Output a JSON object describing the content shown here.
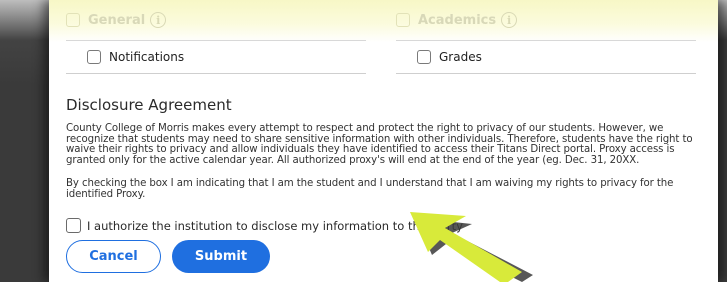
{
  "permissions": {
    "left_group": {
      "heading": "General",
      "item": "Notifications"
    },
    "right_group": {
      "heading": "Academics",
      "item": "Grades"
    }
  },
  "disclosure": {
    "title": "Disclosure Agreement",
    "paragraph1": "County College of Morris makes every attempt to respect and protect the right to privacy of our students. However, we recognize that students may need to share sensitive information with other individuals. Therefore, students have the right to waive their rights to privacy and allow individuals they have identified to access their Titans Direct portal. Proxy access is granted only for the active calendar year. All authorized proxy's will end at the end of the year (eg. Dec. 31, 20XX.",
    "paragraph2": "By checking the box I am indicating that I am the student and I understand that I am waiving my rights to privacy for the identified Proxy.",
    "authorize_label": "I authorize the institution to disclose my information to this party"
  },
  "actions": {
    "cancel_label": "Cancel",
    "submit_label": "Submit"
  },
  "colors": {
    "accent": "#1f6fe0",
    "highlight": "#f7f7c6",
    "pointer_arrow": "#d8ea3a"
  },
  "icons": {
    "info": "info-icon",
    "pointer": "pointer-arrow"
  }
}
